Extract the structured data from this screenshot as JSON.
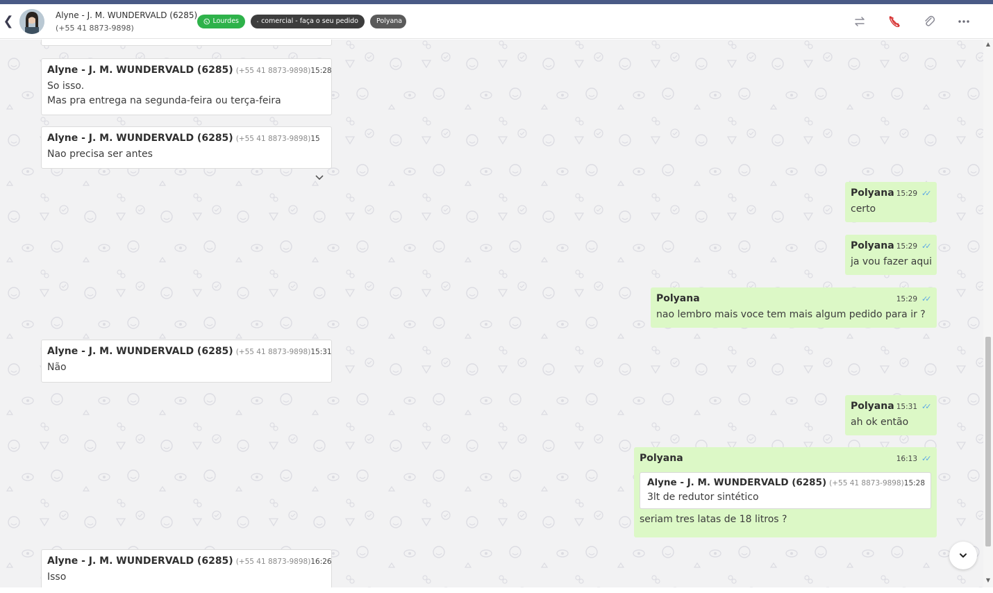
{
  "header": {
    "contact_name": "Alyne - J. M. WUNDERVALD (6285)",
    "contact_phone": "(+55 41 8873-9898)",
    "tags": [
      {
        "label": "Lourdes",
        "icon": "whatsapp-icon",
        "color": "#2eb24a"
      },
      {
        "label": "comercial - faça o seu pedido",
        "icon": "sitemap-icon",
        "color": "#3d3d3d"
      },
      {
        "label": "Polyana",
        "color": "#5a5a5a"
      }
    ],
    "actions": [
      "transfer-icon",
      "end-call-icon",
      "attach-icon",
      "more-icon"
    ]
  },
  "messages": [
    {
      "direction": "in",
      "sender": "Alyne - J. M. WUNDERVALD (6285)",
      "phone": "(+55 41 8873-9898)",
      "time": "15:28",
      "lines": [
        "So isso.",
        "Mas pra entrega na segunda-feira ou terça-feira"
      ]
    },
    {
      "direction": "in",
      "sender": "Alyne - J. M. WUNDERVALD (6285)",
      "phone": "(+55 41 8873-9898)",
      "time": "15",
      "lines": [
        "Nao precisa ser antes"
      ]
    },
    {
      "direction": "out",
      "sender": "Polyana",
      "time": "15:29",
      "lines": [
        "certo"
      ]
    },
    {
      "direction": "out",
      "sender": "Polyana",
      "time": "15:29",
      "lines": [
        "ja vou fazer aqui"
      ]
    },
    {
      "direction": "out",
      "sender": "Polyana",
      "time": "15:29",
      "lines": [
        "nao lembro mais voce tem mais algum pedido para ir ?"
      ]
    },
    {
      "direction": "in",
      "sender": "Alyne - J. M. WUNDERVALD (6285)",
      "phone": "(+55 41 8873-9898)",
      "time": "15:31",
      "lines": [
        "Não"
      ]
    },
    {
      "direction": "out",
      "sender": "Polyana",
      "time": "15:31",
      "lines": [
        "ah ok então"
      ]
    },
    {
      "direction": "out",
      "sender": "Polyana",
      "time": "16:13",
      "quote": {
        "sender": "Alyne - J. M. WUNDERVALD (6285)",
        "phone": "(+55 41 8873-9898)",
        "time": "15:28",
        "text": "3lt de redutor sintético"
      },
      "lines": [
        "seriam tres latas de 18 litros ?"
      ]
    },
    {
      "direction": "in",
      "sender": "Alyne - J. M. WUNDERVALD (6285)",
      "phone": "(+55 41 8873-9898)",
      "time": "16:26",
      "lines": [
        "Isso"
      ]
    }
  ],
  "colors": {
    "outgoing_bubble": "#dcf8c6",
    "incoming_bubble": "#ffffff",
    "read_ticks": "#5aa6e6",
    "chat_background": "#f2f2f3"
  }
}
